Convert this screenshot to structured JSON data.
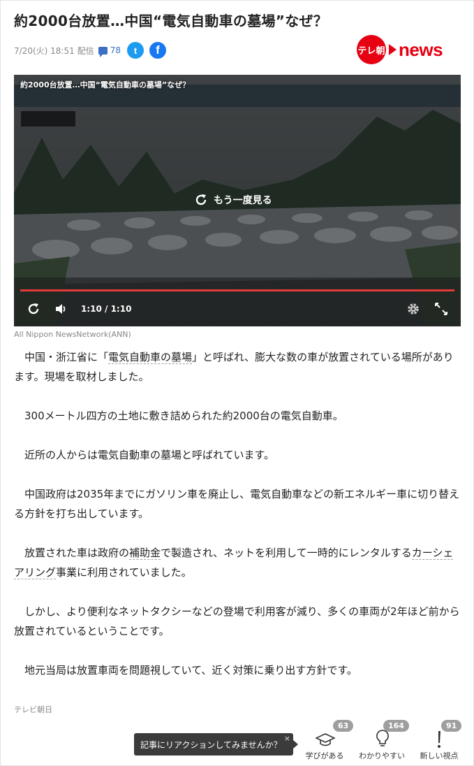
{
  "header": {
    "title": "約2000台放置…中国“電気自動車の墓場”なぜ？",
    "date": "7/20(火) 18:51",
    "delivery": "配信",
    "comment_count": "78",
    "twitter_glyph": "t",
    "facebook_glyph": "f"
  },
  "brand": {
    "badge": "テレ朝",
    "word": "news"
  },
  "video": {
    "title": "約2000台放置…中国“電気自動車の墓場”なぜ？",
    "replay_label": "もう一度見る",
    "time": "1:10 / 1:10",
    "progress": 1.0,
    "credit": "All Nippon NewsNetwork(ANN)"
  },
  "article": {
    "p1_a": "中国・浙江省に「",
    "p1_kw": "電気自動車の墓場",
    "p1_b": "」と呼ばれ、膨大な数の車が放置されている場所があります。現場を取材しました。",
    "p2": "300メートル四方の土地に敷き詰められた約2000台の電気自動車。",
    "p3": "近所の人からは電気自動車の墓場と呼ばれています。",
    "p4": "中国政府は2035年までにガソリン車を廃止し、電気自動車などの新エネルギー車に切り替える方針を打ち出しています。",
    "p5_a": "放置された車は政府の",
    "p5_kw1": "補助金",
    "p5_b": "で製造され、ネットを利用して一時的にレンタルする",
    "p5_kw2": "カーシェアリング",
    "p5_c": "事業に利用されていました。",
    "p6": "しかし、より便利なネットタクシーなどの登場で利用客が減り、多くの車両が2年ほど前から放置されているということです。",
    "p7": "地元当局は放置車両を問題視していて、近く対策に乗り出す方針です。",
    "source": "テレビ朝日"
  },
  "reactions": {
    "prompt": "記事にリアクションしてみませんか？",
    "close": "×",
    "items": [
      {
        "label": "学びがある",
        "count": "63",
        "icon": "graduation-cap-icon"
      },
      {
        "label": "わかりやすい",
        "count": "164",
        "icon": "lightbulb-icon"
      },
      {
        "label": "新しい視点",
        "count": "91",
        "icon": "exclamation-icon"
      }
    ]
  },
  "colors": {
    "accent_red": "#e60012",
    "link_blue": "#3a6fc4",
    "progress_red": "#e33a3a"
  }
}
